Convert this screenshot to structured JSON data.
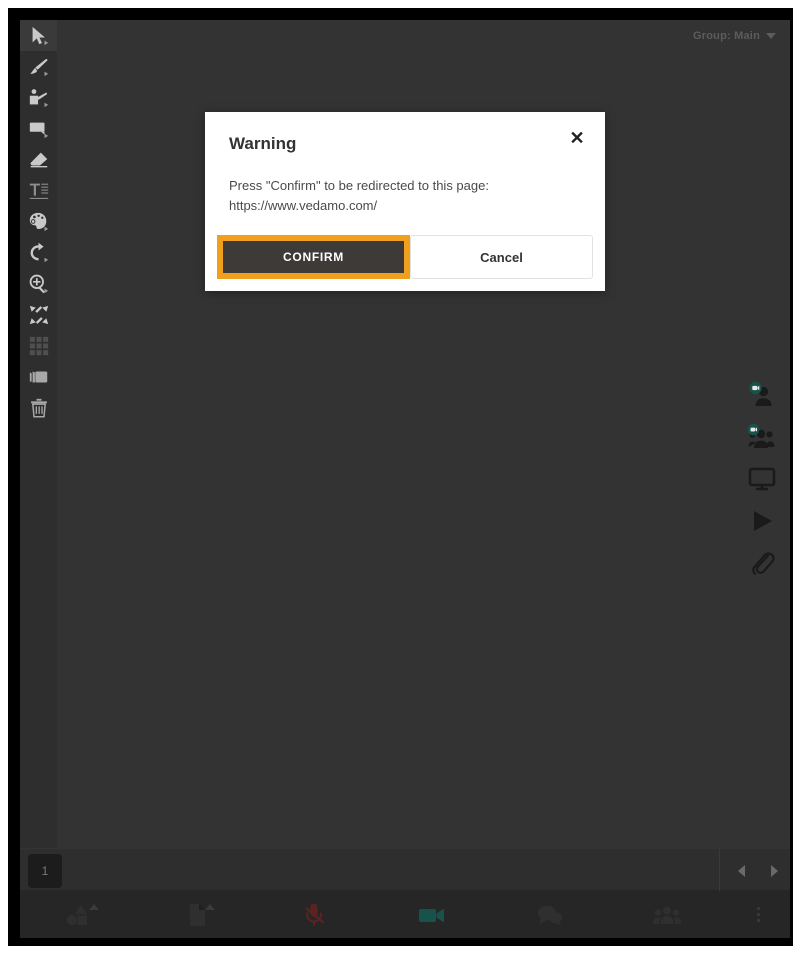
{
  "app": {
    "group_label": "Group: Main",
    "group_caret_icon": "chevron-down-icon"
  },
  "colors": {
    "accent_orange": "#f0a01c",
    "dialog_button_dark": "#3d3a38",
    "canvas_bg": "#333333",
    "toolbar_bg": "#2e2e2e",
    "bottom_bar_bg": "#262626",
    "video_on_teal": "#17534a",
    "mic_muted_red": "#5c2222"
  },
  "toolbar": {
    "items": [
      {
        "name": "select-tool",
        "icon": "cursor-arrow-icon",
        "active": true,
        "has_submenu": true
      },
      {
        "name": "pen-tool",
        "icon": "brush-icon",
        "active": false,
        "has_submenu": true
      },
      {
        "name": "pointer-tool",
        "icon": "presenter-icon",
        "active": false,
        "has_submenu": true
      },
      {
        "name": "shape-tool",
        "icon": "filled-rect-icon",
        "active": false,
        "has_submenu": true
      },
      {
        "name": "eraser-tool",
        "icon": "eraser-icon",
        "active": false,
        "has_submenu": false
      },
      {
        "name": "text-tool",
        "icon": "text-icon",
        "active": false,
        "has_submenu": false
      },
      {
        "name": "color-tool",
        "icon": "palette-icon",
        "active": false,
        "has_submenu": true
      },
      {
        "name": "undo-tool",
        "icon": "undo-arrow-icon",
        "active": false,
        "has_submenu": true
      },
      {
        "name": "zoom-tool",
        "icon": "magnifier-plus-icon",
        "active": false,
        "has_submenu": true
      },
      {
        "name": "fit-tool",
        "icon": "collapse-arrows-icon",
        "active": false,
        "has_submenu": false
      },
      {
        "name": "grid-tool",
        "icon": "grid-icon",
        "active": false,
        "has_submenu": false
      },
      {
        "name": "duplicate-tool",
        "icon": "layers-icon",
        "active": false,
        "has_submenu": false
      },
      {
        "name": "delete-tool",
        "icon": "trash-icon",
        "active": false,
        "has_submenu": false
      }
    ]
  },
  "right_rail": {
    "items": [
      {
        "name": "my-video",
        "icon": "person-video-icon"
      },
      {
        "name": "participants-video",
        "icon": "group-video-icon"
      },
      {
        "name": "screen-share",
        "icon": "monitor-icon"
      },
      {
        "name": "media-player",
        "icon": "play-icon"
      },
      {
        "name": "attachments",
        "icon": "paperclip-icon"
      }
    ]
  },
  "pages": {
    "current_page_label": "1",
    "prev_icon": "chevron-left-icon",
    "next_icon": "chevron-right-icon"
  },
  "bottom_bar": {
    "items": [
      {
        "name": "shapes-menu",
        "icon": "shapes-icon",
        "caret": true,
        "state": "default"
      },
      {
        "name": "files-menu",
        "icon": "file-icon",
        "caret": true,
        "state": "default"
      },
      {
        "name": "microphone-toggle",
        "icon": "mic-muted-icon",
        "caret": false,
        "state": "muted"
      },
      {
        "name": "camera-toggle",
        "icon": "video-camera-icon",
        "caret": false,
        "state": "on"
      },
      {
        "name": "chat-panel",
        "icon": "chat-bubbles-icon",
        "caret": false,
        "state": "default"
      },
      {
        "name": "participants-panel",
        "icon": "people-icon",
        "caret": false,
        "state": "default"
      }
    ],
    "more_menu": {
      "name": "more-menu",
      "icon": "kebab-menu-icon"
    }
  },
  "dialog": {
    "title": "Warning",
    "close_icon": "close-icon",
    "message_line1": "Press \"Confirm\" to be redirected to this page:",
    "message_url": "https://www.vedamo.com/",
    "confirm_label": "CONFIRM",
    "cancel_label": "Cancel"
  }
}
